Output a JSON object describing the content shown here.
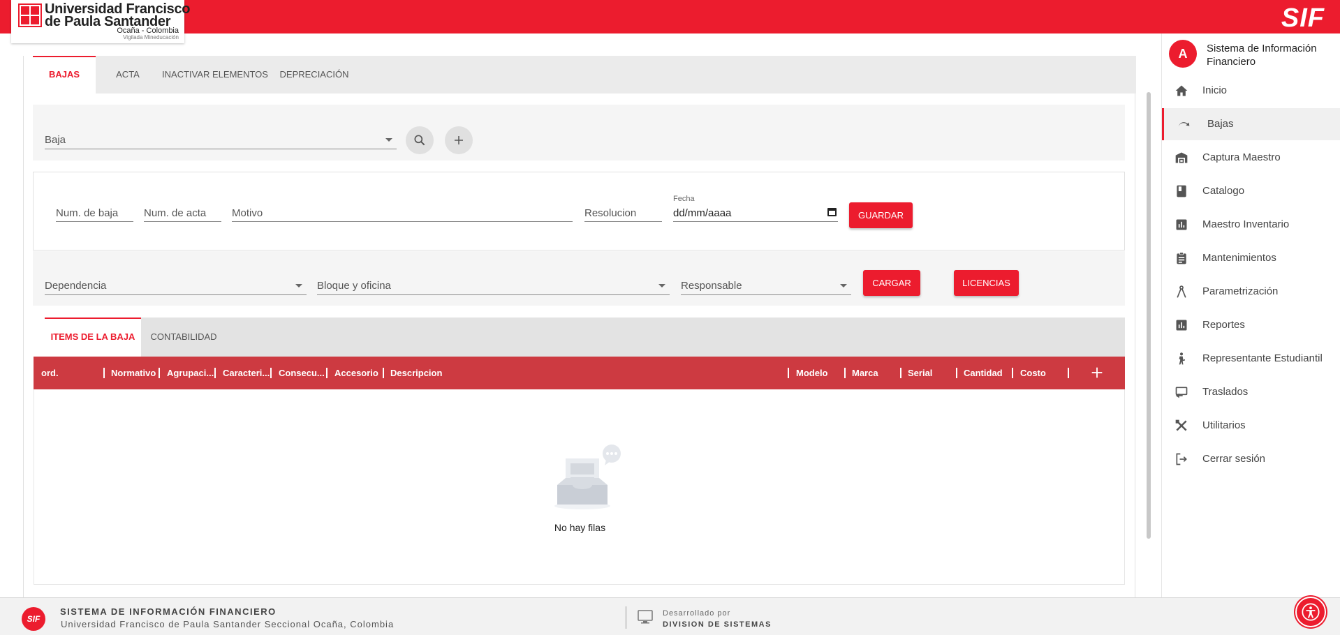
{
  "header": {
    "logo_line1": "Universidad Francisco",
    "logo_line2": "de Paula Santander",
    "logo_line3": "Ocaña - Colombia",
    "logo_line4": "Vigilada Mineducación",
    "brand": "SIF"
  },
  "tabs_main": [
    {
      "label": "BAJAS",
      "active": true
    },
    {
      "label": "ACTA",
      "active": false
    },
    {
      "label": "INACTIVAR ELEMENTOS",
      "active": false
    },
    {
      "label": "DEPRECIACIÓN",
      "active": false
    }
  ],
  "search": {
    "baja_label": "Baja",
    "search_icon": "search-icon",
    "add_icon": "plus-icon"
  },
  "form": {
    "num_baja": "Num. de baja",
    "num_acta": "Num. de acta",
    "motivo": "Motivo",
    "resolucion": "Resolucion",
    "fecha_label": "Fecha",
    "fecha_value": "dd/mm/aaaa",
    "guardar": "GUARDAR"
  },
  "filters": {
    "dependencia": "Dependencia",
    "bloque": "Bloque y oficina",
    "responsable": "Responsable",
    "cargar": "CARGAR",
    "licencias": "LICENCIAS"
  },
  "tabs_items": [
    {
      "label": "ITEMS DE LA BAJA",
      "active": true
    },
    {
      "label": "CONTABILIDAD",
      "active": false
    }
  ],
  "grid": {
    "columns": [
      "ord.",
      "Normativo",
      "Agrupaci...",
      "Caracteri...",
      "Consecu...",
      "Accesorio",
      "Descripcion",
      "Modelo",
      "Marca",
      "Serial",
      "Cantidad",
      "Costo"
    ],
    "add_icon": "plus-icon",
    "empty_text": "No hay filas"
  },
  "sidebar": {
    "avatar": "A",
    "title": "Sistema de Información Financiero",
    "items": [
      {
        "label": "Inicio",
        "icon": "home-icon",
        "active": false
      },
      {
        "label": "Bajas",
        "icon": "redo-icon",
        "active": true
      },
      {
        "label": "Captura Maestro",
        "icon": "warehouse-icon",
        "active": false
      },
      {
        "label": "Catalogo",
        "icon": "book-icon",
        "active": false
      },
      {
        "label": "Maestro Inventario",
        "icon": "bar-chart-icon",
        "active": false
      },
      {
        "label": "Mantenimientos",
        "icon": "clipboard-icon",
        "active": false
      },
      {
        "label": "Parametrización",
        "icon": "compass-icon",
        "active": false
      },
      {
        "label": "Reportes",
        "icon": "bar-chart-icon",
        "active": false
      },
      {
        "label": "Representante Estudiantil",
        "icon": "person-walking-icon",
        "active": false
      },
      {
        "label": "Traslados",
        "icon": "transfer-icon",
        "active": false
      },
      {
        "label": "Utilitarios",
        "icon": "tools-icon",
        "active": false
      },
      {
        "label": "Cerrar sesión",
        "icon": "logout-icon",
        "active": false
      }
    ]
  },
  "footer": {
    "logo": "SIF",
    "line1": "SISTEMA DE INFORMACIÓN FINANCIERO",
    "line2": "Universidad Francisco de Paula Santander Seccional Ocaña, Colombia",
    "dev_line1": "Desarrollado por",
    "dev_line2": "DIVISION DE SISTEMAS"
  },
  "colors": {
    "primary": "#ec1c2e",
    "grid_header": "#cd3a41"
  }
}
